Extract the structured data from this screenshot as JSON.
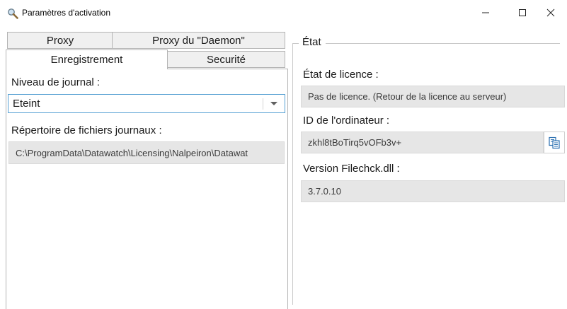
{
  "window": {
    "title": "Paramètres d'activation",
    "controls": {
      "minimize": "—",
      "maximize": "☐",
      "close": "✕"
    }
  },
  "tabs": {
    "row1": [
      "Proxy",
      "Proxy du \"Daemon\""
    ],
    "row2": [
      "Enregistrement",
      "Securité"
    ],
    "active": "Enregistrement"
  },
  "logging": {
    "level_label": "Niveau de journal :",
    "level_value": "Eteint",
    "directory_label": "Répertoire de fichiers journaux :",
    "directory_value": "C:\\ProgramData\\Datawatch\\Licensing\\Nalpeiron\\Datawat"
  },
  "status": {
    "group_title": "État",
    "license_label": "État de licence :",
    "license_value": "Pas de licence. (Retour de la licence au serveur)",
    "computer_id_label": "ID de l'ordinateur :",
    "computer_id_value": "zkhl8tBoTirq5vOFb3v+",
    "version_label": "Version Filechck.dll :",
    "version_value": "3.7.0.10"
  },
  "icons": {
    "app": "magnifier-key-icon",
    "copy": "copy-clipboard-icon"
  }
}
